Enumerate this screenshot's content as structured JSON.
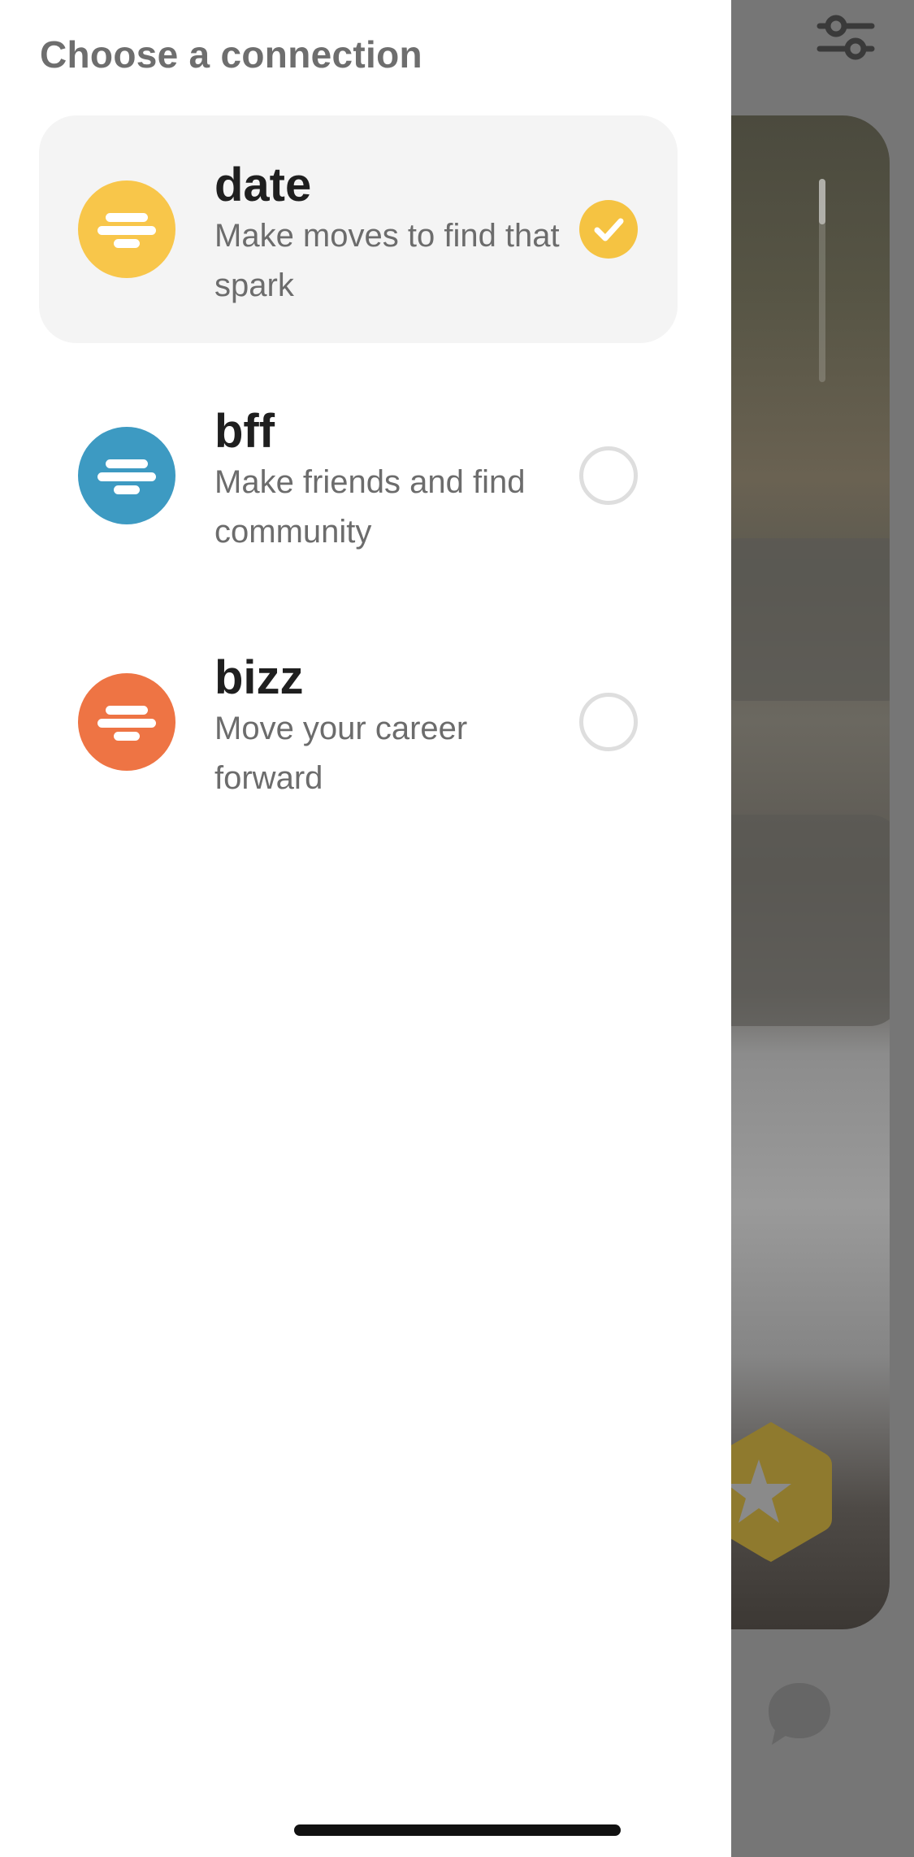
{
  "drawer": {
    "title": "Choose a connection"
  },
  "options": [
    {
      "name": "date",
      "description": "Make moves to find that spark",
      "color": "#F8C64A",
      "selected": true,
      "icon": "bumble-logo-icon"
    },
    {
      "name": "bff",
      "description": "Make friends and find community",
      "color": "#3D9AC2",
      "selected": false,
      "icon": "bumble-logo-icon"
    },
    {
      "name": "bizz",
      "description": "Move your career forward",
      "color": "#EE7444",
      "selected": false,
      "icon": "bumble-logo-icon"
    }
  ],
  "colors": {
    "selected_row_background": "#F4F4F4",
    "selected_check": "#F5C342",
    "overlay": "#767676"
  },
  "background": {
    "icons": [
      "filter-icon",
      "superswipe-star-icon",
      "chat-icon"
    ]
  }
}
